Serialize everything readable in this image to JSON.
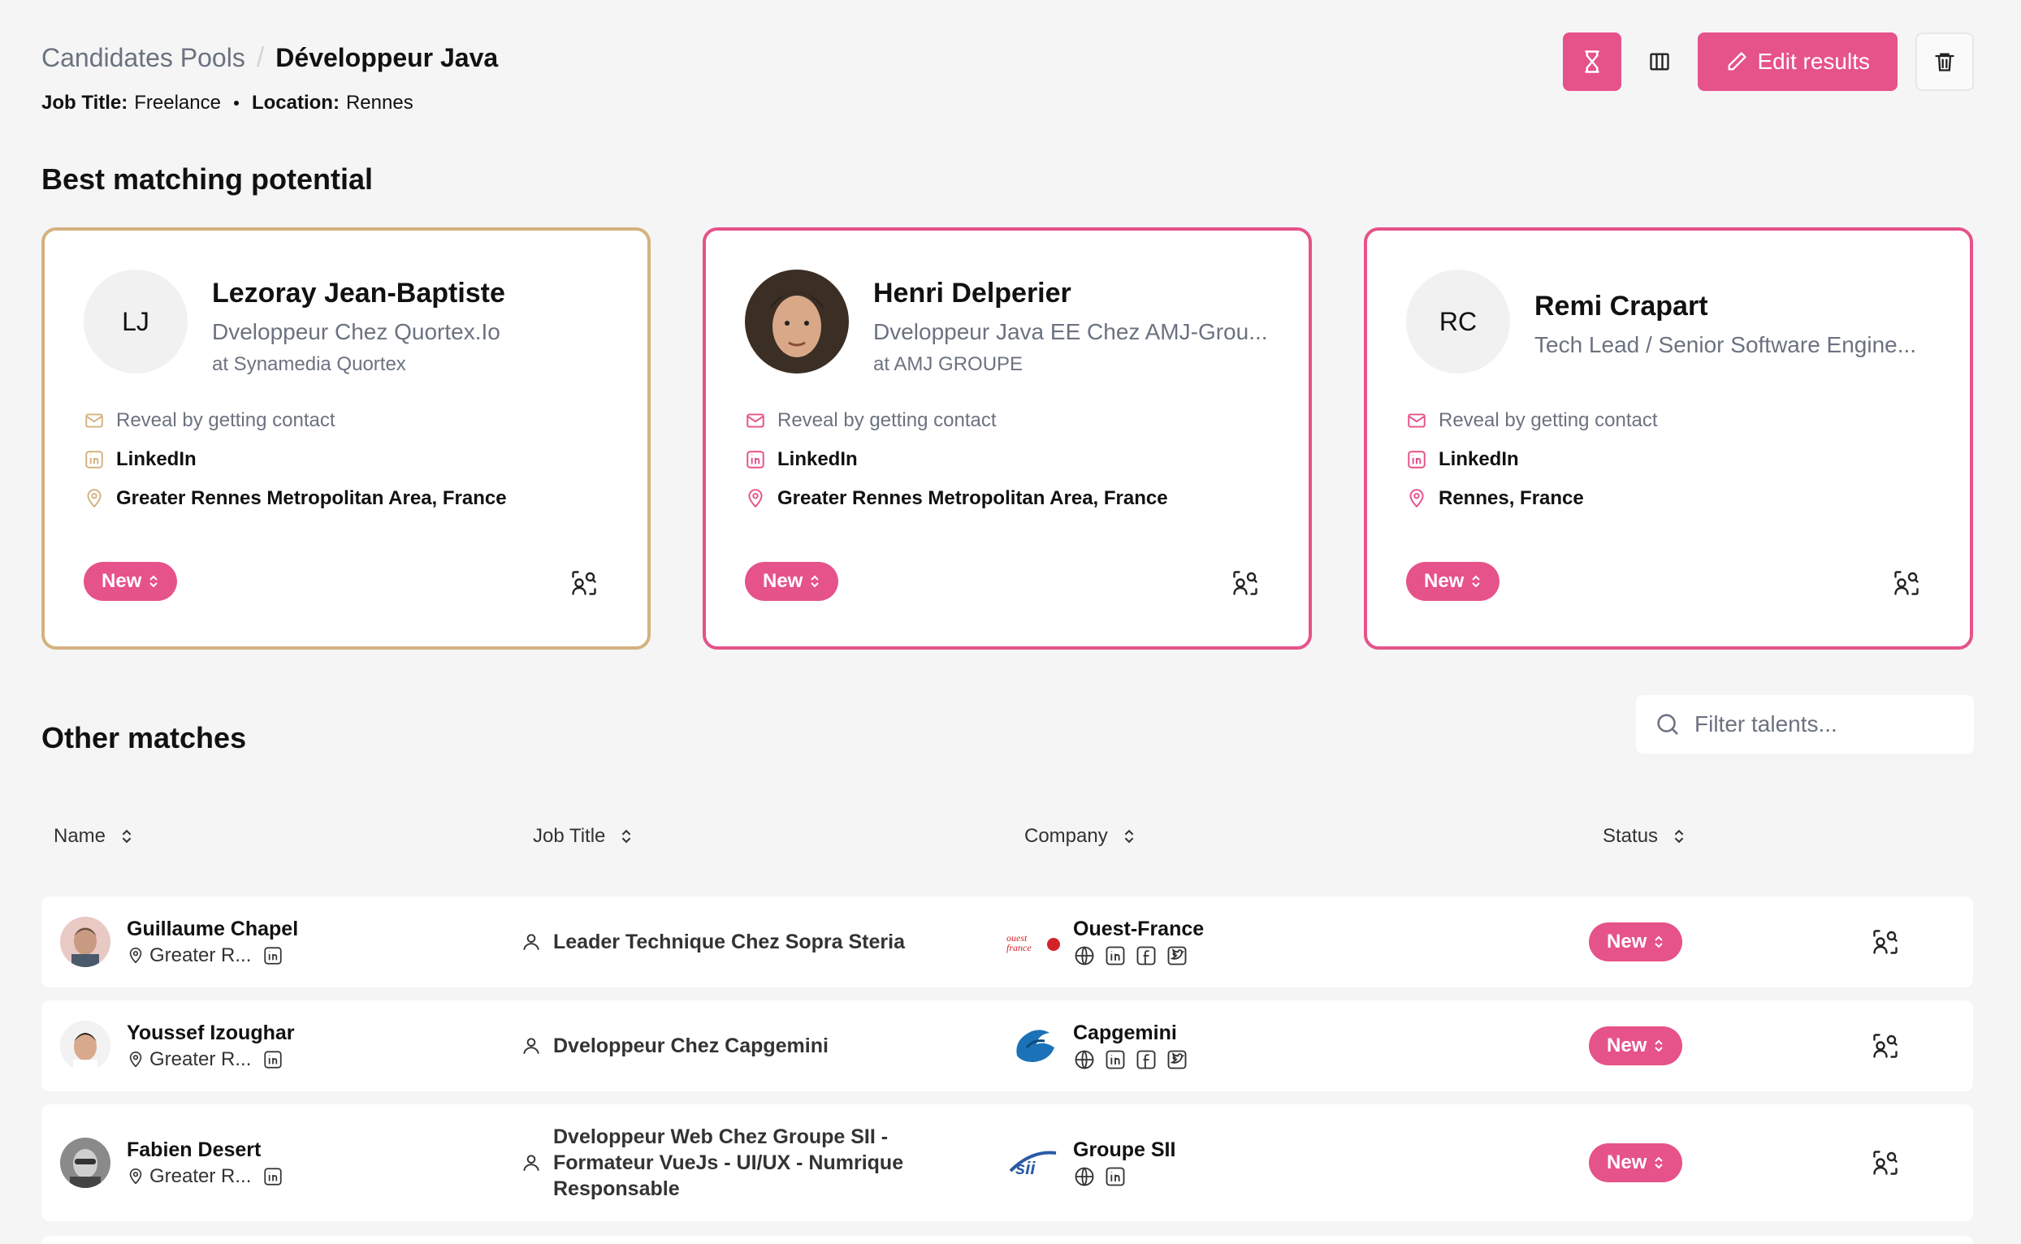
{
  "breadcrumb": {
    "root": "Candidates Pools",
    "separator": "/",
    "current": "Développeur Java"
  },
  "meta": {
    "job_title_label": "Job Title:",
    "job_title": "Freelance",
    "location_label": "Location:",
    "location": "Rennes"
  },
  "toolbar": {
    "edit_label": "Edit results"
  },
  "best_section": {
    "title": "Best matching potential"
  },
  "best_matches": [
    {
      "initials": "LJ",
      "name": "Lezoray Jean-Baptiste",
      "title": "Dveloppeur Chez Quortex.Io",
      "company": "at Synamedia Quortex",
      "email": "Reveal by getting contact",
      "linkedin": "LinkedIn",
      "location": "Greater Rennes Metropolitan Area, France",
      "status": "New",
      "highlight": "gold"
    },
    {
      "initials": "",
      "name": "Henri Delperier",
      "title": "Dveloppeur Java EE Chez AMJ-Grou...",
      "company": "at AMJ GROUPE",
      "email": "Reveal by getting contact",
      "linkedin": "LinkedIn",
      "location": "Greater Rennes Metropolitan Area, France",
      "status": "New",
      "highlight": "pink"
    },
    {
      "initials": "RC",
      "name": "Remi Crapart",
      "title": "Tech Lead / Senior Software Engine...",
      "company": "",
      "email": "Reveal by getting contact",
      "linkedin": "LinkedIn",
      "location": "Rennes, France",
      "status": "New",
      "highlight": "pink"
    }
  ],
  "other_section": {
    "title": "Other matches"
  },
  "filter": {
    "placeholder": "Filter talents..."
  },
  "table": {
    "columns": [
      "Name",
      "Job Title",
      "Company",
      "Status"
    ],
    "rows": [
      {
        "name": "Guillaume Chapel",
        "location": "Greater R...",
        "job": "Leader Technique Chez Sopra Steria",
        "company": "Ouest-France",
        "logo_text": "ouest france",
        "socials": [
          "globe",
          "linkedin",
          "facebook",
          "twitter"
        ],
        "status": "New"
      },
      {
        "name": "Youssef Izoughar",
        "location": "Greater R...",
        "job": "Dveloppeur Chez Capgemini",
        "company": "Capgemini",
        "socials": [
          "globe",
          "linkedin",
          "facebook",
          "twitter"
        ],
        "status": "New"
      },
      {
        "name": "Fabien Desert",
        "location": "Greater R...",
        "job": "Dveloppeur Web Chez Groupe SII - Formateur VueJs - UI/UX - Numrique Responsable",
        "company": "Groupe SII",
        "socials": [
          "globe",
          "linkedin"
        ],
        "status": "New"
      }
    ]
  },
  "colors": {
    "accent": "#e6528a",
    "gold_border": "#d4b27f",
    "background": "#f5f5f5",
    "muted_text": "#6b7280"
  }
}
